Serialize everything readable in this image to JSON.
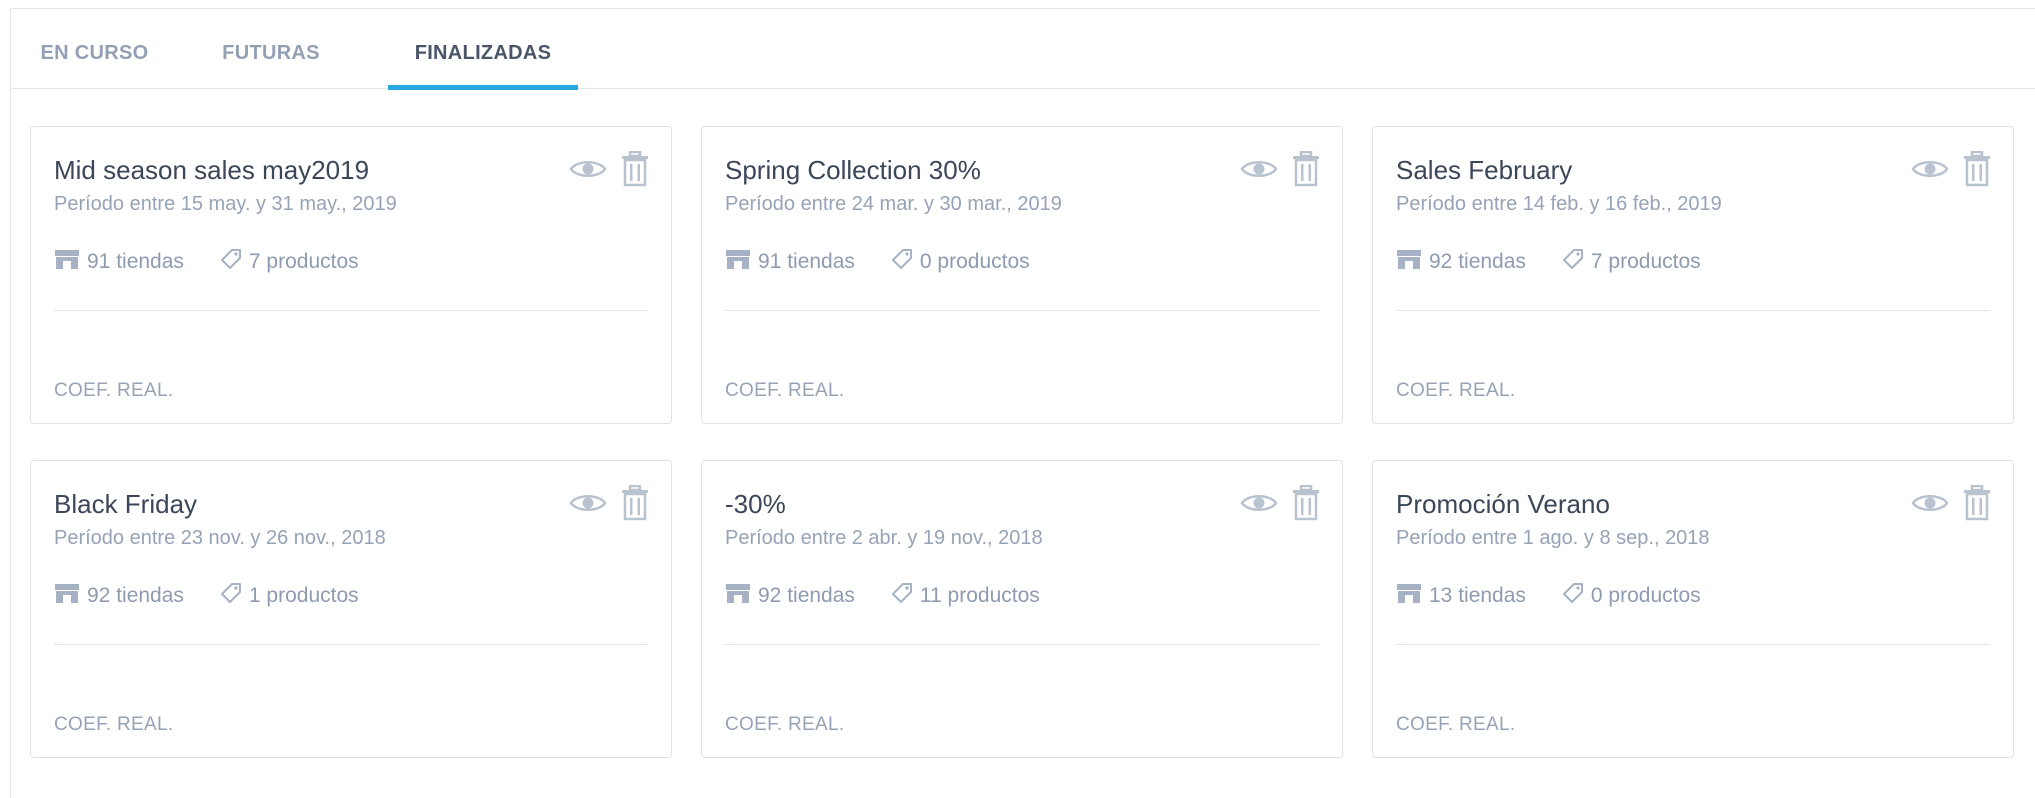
{
  "tabs": [
    {
      "label": "EN CURSO"
    },
    {
      "label": "FUTURAS"
    },
    {
      "label": "FINALIZADAS"
    }
  ],
  "active_tab": "FINALIZADAS",
  "colors": {
    "accent": "#29a9e1",
    "title": "#3b4658",
    "muted": "#96a3b6",
    "border": "#dfe3e8"
  },
  "icons": {
    "view": "eye-icon",
    "delete": "trash-icon",
    "stores": "store-icon",
    "products": "tag-icon"
  },
  "cards": [
    {
      "title": "Mid season sales may2019",
      "period": "Período entre 15 may. y 31 may., 2019",
      "stores": "91 tiendas",
      "products": "7 productos",
      "coef": "COEF. REAL."
    },
    {
      "title": "Spring Collection 30%",
      "period": "Período entre 24 mar. y 30 mar., 2019",
      "stores": "91 tiendas",
      "products": "0 productos",
      "coef": "COEF. REAL."
    },
    {
      "title": "Sales February",
      "period": "Período entre 14 feb. y 16 feb., 2019",
      "stores": "92 tiendas",
      "products": "7 productos",
      "coef": "COEF. REAL."
    },
    {
      "title": "Black Friday",
      "period": "Período entre 23 nov. y 26 nov., 2018",
      "stores": "92 tiendas",
      "products": "1 productos",
      "coef": "COEF. REAL."
    },
    {
      "title": "-30%",
      "period": "Período entre 2 abr. y 19 nov., 2018",
      "stores": "92 tiendas",
      "products": "11 productos",
      "coef": "COEF. REAL."
    },
    {
      "title": "Promoción Verano",
      "period": "Período entre 1 ago. y 8 sep., 2018",
      "stores": "13 tiendas",
      "products": "0 productos",
      "coef": "COEF. REAL."
    }
  ]
}
